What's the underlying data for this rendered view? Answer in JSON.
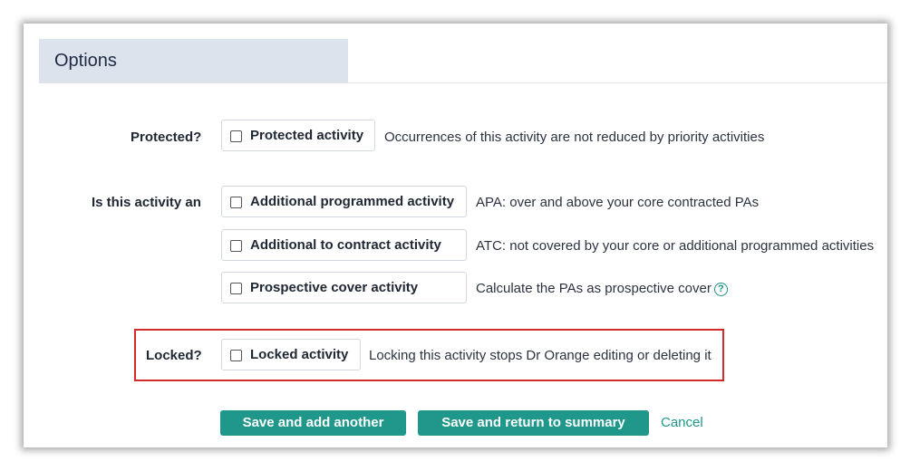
{
  "section": {
    "title": "Options"
  },
  "rows": {
    "protected": {
      "label": "Protected?",
      "option": {
        "label": "Protected activity",
        "checked": false
      },
      "description": "Occurrences of this activity are not reduced by priority activities"
    },
    "activity_type": {
      "label": "Is this activity an",
      "options": [
        {
          "label": "Additional programmed activity",
          "checked": false,
          "description": "APA: over and above your core contracted PAs"
        },
        {
          "label": "Additional to contract activity",
          "checked": false,
          "description": "ATC: not covered by your core or additional programmed activities"
        },
        {
          "label": "Prospective cover activity",
          "checked": false,
          "description": "Calculate the PAs as prospective cover",
          "help_icon": "question-circle-icon"
        }
      ]
    },
    "locked": {
      "label": "Locked?",
      "option": {
        "label": "Locked activity",
        "checked": false
      },
      "description": "Locking this activity stops Dr Orange editing or deleting it"
    }
  },
  "actions": {
    "save_add_another": "Save and add another",
    "save_return": "Save and return to summary",
    "cancel": "Cancel"
  },
  "colors": {
    "accent": "#1f978a",
    "highlight_border": "#d32a2a",
    "tab_background": "#dde3ec"
  }
}
